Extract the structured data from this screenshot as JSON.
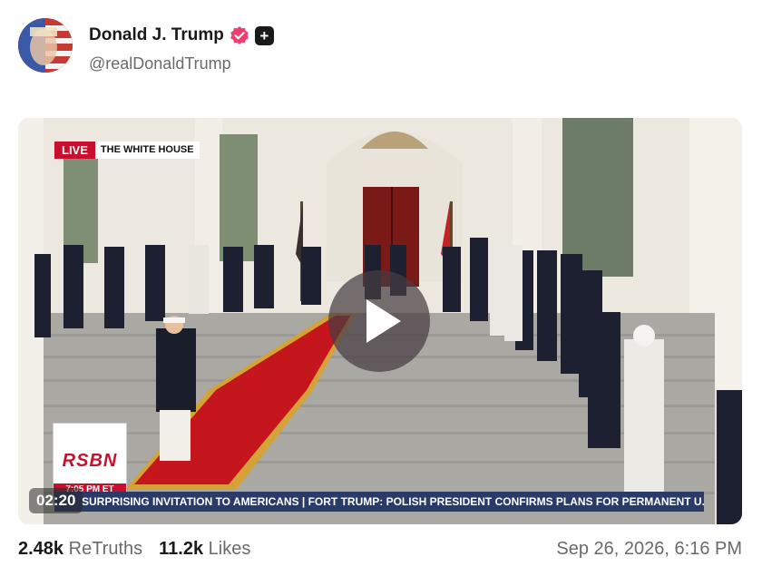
{
  "post": {
    "author_name": "Donald J. Trump",
    "author_handle": "@realDonaldTrump",
    "verified_icon": "verified-badge-icon",
    "follow_icon": "plus-icon"
  },
  "video": {
    "live_label": "LIVE",
    "location_label": "THE WHITE HOUSE",
    "network_logo": "RSBN",
    "network_time": "7:05 PM ET",
    "ticker_text": "SURPRISING INVITATION TO AMERICANS  |  FORT TRUMP: POLISH PRESIDENT CONFIRMS PLANS FOR PERMANENT U.",
    "timecode": "02:20",
    "play_icon": "play-icon"
  },
  "stats": {
    "retruths_count": "2.48k",
    "retruths_label": "ReTruths",
    "likes_count": "11.2k",
    "likes_label": "Likes",
    "timestamp": "Sep 26, 2026, 6:16 PM"
  },
  "colors": {
    "verified": "#ee3c6e",
    "live_red": "#c8102e",
    "ticker_blue": "#2a3b6a",
    "carpet_red": "#c4161c"
  }
}
